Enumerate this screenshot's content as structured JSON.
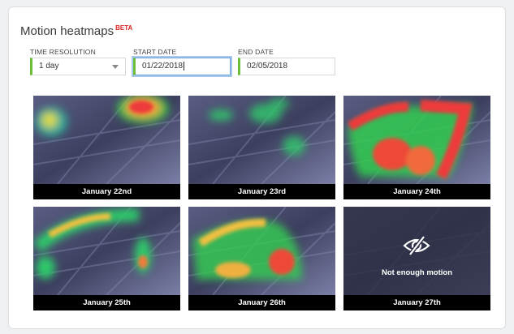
{
  "header": {
    "title": "Motion heatmaps",
    "badge": "BETA"
  },
  "filters": {
    "time_resolution": {
      "label": "TIME RESOLUTION",
      "value": "1 day"
    },
    "start_date": {
      "label": "START DATE",
      "value": "01/22/2018"
    },
    "end_date": {
      "label": "END DATE",
      "value": "02/05/2018"
    }
  },
  "heatmaps": [
    {
      "date": "January 22nd"
    },
    {
      "date": "January 23rd"
    },
    {
      "date": "January 24th"
    },
    {
      "date": "January 25th"
    },
    {
      "date": "January 26th"
    },
    {
      "date": "January 27th",
      "message": "Not enough motion"
    }
  ],
  "colors": {
    "accent_green": "#6cbf3a",
    "beta_red": "#dd2222",
    "focus_blue": "#6a9fd8"
  }
}
